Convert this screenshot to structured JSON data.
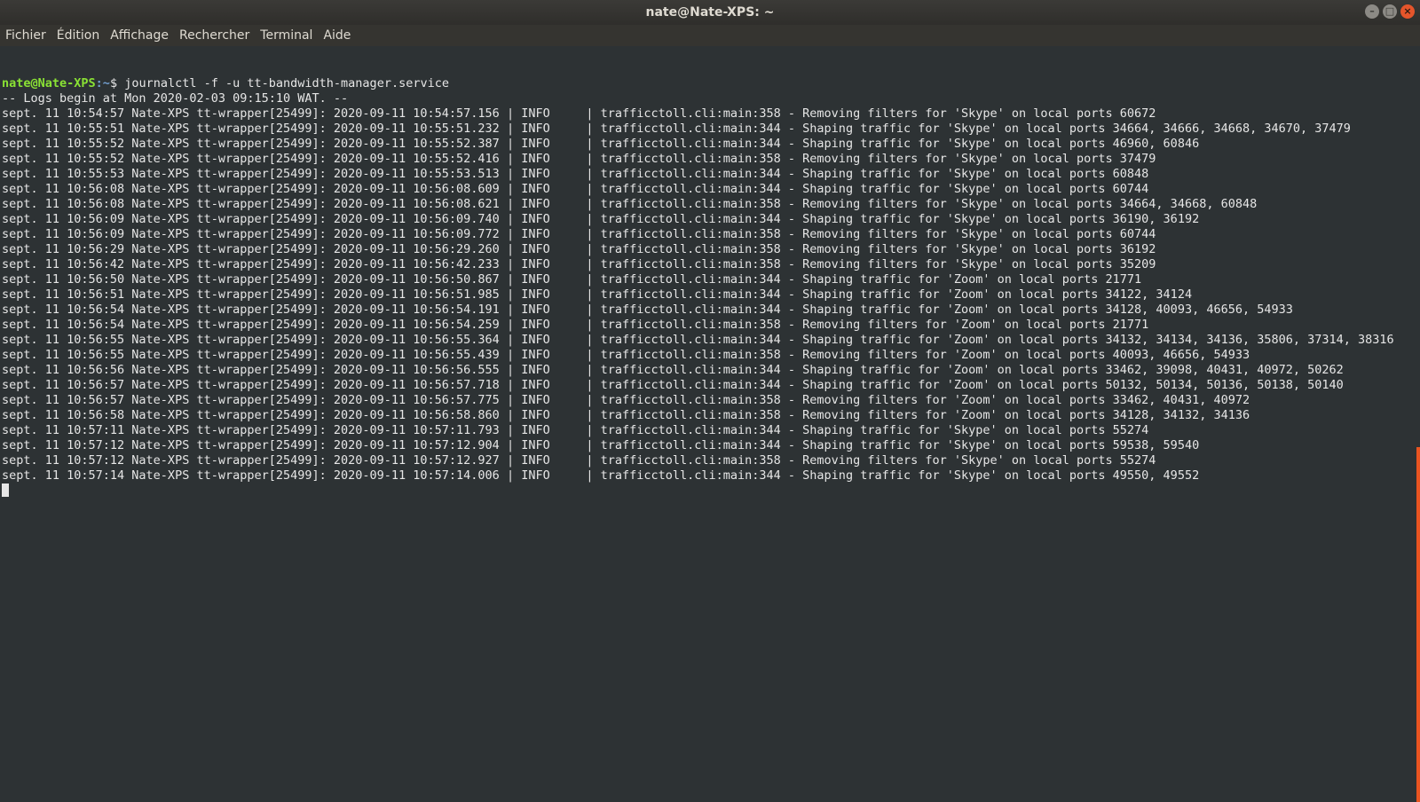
{
  "window": {
    "title": "nate@Nate-XPS: ~",
    "buttons": {
      "minimize": "–",
      "maximize": "□",
      "close": "×"
    }
  },
  "menu": [
    "Fichier",
    "Édition",
    "Affichage",
    "Rechercher",
    "Terminal",
    "Aide"
  ],
  "prompt": {
    "user_host": "nate@Nate-XPS",
    "path": ":~",
    "symbol": "$",
    "command": "journalctl -f -u tt-bandwidth-manager.service"
  },
  "logs_begin": "-- Logs begin at Mon 2020-02-03 09:15:10 WAT. --",
  "log_lines": [
    "sept. 11 10:54:57 Nate-XPS tt-wrapper[25499]: 2020-09-11 10:54:57.156 | INFO     | trafficctoll.cli:main:358 - Removing filters for 'Skype' on local ports 60672",
    "sept. 11 10:55:51 Nate-XPS tt-wrapper[25499]: 2020-09-11 10:55:51.232 | INFO     | trafficctoll.cli:main:344 - Shaping traffic for 'Skype' on local ports 34664, 34666, 34668, 34670, 37479",
    "sept. 11 10:55:52 Nate-XPS tt-wrapper[25499]: 2020-09-11 10:55:52.387 | INFO     | trafficctoll.cli:main:344 - Shaping traffic for 'Skype' on local ports 46960, 60846",
    "sept. 11 10:55:52 Nate-XPS tt-wrapper[25499]: 2020-09-11 10:55:52.416 | INFO     | trafficctoll.cli:main:358 - Removing filters for 'Skype' on local ports 37479",
    "sept. 11 10:55:53 Nate-XPS tt-wrapper[25499]: 2020-09-11 10:55:53.513 | INFO     | trafficctoll.cli:main:344 - Shaping traffic for 'Skype' on local ports 60848",
    "sept. 11 10:56:08 Nate-XPS tt-wrapper[25499]: 2020-09-11 10:56:08.609 | INFO     | trafficctoll.cli:main:344 - Shaping traffic for 'Skype' on local ports 60744",
    "sept. 11 10:56:08 Nate-XPS tt-wrapper[25499]: 2020-09-11 10:56:08.621 | INFO     | trafficctoll.cli:main:358 - Removing filters for 'Skype' on local ports 34664, 34668, 60848",
    "sept. 11 10:56:09 Nate-XPS tt-wrapper[25499]: 2020-09-11 10:56:09.740 | INFO     | trafficctoll.cli:main:344 - Shaping traffic for 'Skype' on local ports 36190, 36192",
    "sept. 11 10:56:09 Nate-XPS tt-wrapper[25499]: 2020-09-11 10:56:09.772 | INFO     | trafficctoll.cli:main:358 - Removing filters for 'Skype' on local ports 60744",
    "sept. 11 10:56:29 Nate-XPS tt-wrapper[25499]: 2020-09-11 10:56:29.260 | INFO     | trafficctoll.cli:main:358 - Removing filters for 'Skype' on local ports 36192",
    "sept. 11 10:56:42 Nate-XPS tt-wrapper[25499]: 2020-09-11 10:56:42.233 | INFO     | trafficctoll.cli:main:358 - Removing filters for 'Skype' on local ports 35209",
    "sept. 11 10:56:50 Nate-XPS tt-wrapper[25499]: 2020-09-11 10:56:50.867 | INFO     | trafficctoll.cli:main:344 - Shaping traffic for 'Zoom' on local ports 21771",
    "sept. 11 10:56:51 Nate-XPS tt-wrapper[25499]: 2020-09-11 10:56:51.985 | INFO     | trafficctoll.cli:main:344 - Shaping traffic for 'Zoom' on local ports 34122, 34124",
    "sept. 11 10:56:54 Nate-XPS tt-wrapper[25499]: 2020-09-11 10:56:54.191 | INFO     | trafficctoll.cli:main:344 - Shaping traffic for 'Zoom' on local ports 34128, 40093, 46656, 54933",
    "sept. 11 10:56:54 Nate-XPS tt-wrapper[25499]: 2020-09-11 10:56:54.259 | INFO     | trafficctoll.cli:main:358 - Removing filters for 'Zoom' on local ports 21771",
    "sept. 11 10:56:55 Nate-XPS tt-wrapper[25499]: 2020-09-11 10:56:55.364 | INFO     | trafficctoll.cli:main:344 - Shaping traffic for 'Zoom' on local ports 34132, 34134, 34136, 35806, 37314, 38316",
    "sept. 11 10:56:55 Nate-XPS tt-wrapper[25499]: 2020-09-11 10:56:55.439 | INFO     | trafficctoll.cli:main:358 - Removing filters for 'Zoom' on local ports 40093, 46656, 54933",
    "sept. 11 10:56:56 Nate-XPS tt-wrapper[25499]: 2020-09-11 10:56:56.555 | INFO     | trafficctoll.cli:main:344 - Shaping traffic for 'Zoom' on local ports 33462, 39098, 40431, 40972, 50262",
    "sept. 11 10:56:57 Nate-XPS tt-wrapper[25499]: 2020-09-11 10:56:57.718 | INFO     | trafficctoll.cli:main:344 - Shaping traffic for 'Zoom' on local ports 50132, 50134, 50136, 50138, 50140",
    "sept. 11 10:56:57 Nate-XPS tt-wrapper[25499]: 2020-09-11 10:56:57.775 | INFO     | trafficctoll.cli:main:358 - Removing filters for 'Zoom' on local ports 33462, 40431, 40972",
    "sept. 11 10:56:58 Nate-XPS tt-wrapper[25499]: 2020-09-11 10:56:58.860 | INFO     | trafficctoll.cli:main:358 - Removing filters for 'Zoom' on local ports 34128, 34132, 34136",
    "sept. 11 10:57:11 Nate-XPS tt-wrapper[25499]: 2020-09-11 10:57:11.793 | INFO     | trafficctoll.cli:main:344 - Shaping traffic for 'Skype' on local ports 55274",
    "sept. 11 10:57:12 Nate-XPS tt-wrapper[25499]: 2020-09-11 10:57:12.904 | INFO     | trafficctoll.cli:main:344 - Shaping traffic for 'Skype' on local ports 59538, 59540",
    "sept. 11 10:57:12 Nate-XPS tt-wrapper[25499]: 2020-09-11 10:57:12.927 | INFO     | trafficctoll.cli:main:358 - Removing filters for 'Skype' on local ports 55274",
    "sept. 11 10:57:14 Nate-XPS tt-wrapper[25499]: 2020-09-11 10:57:14.006 | INFO     | trafficctoll.cli:main:344 - Shaping traffic for 'Skype' on local ports 49550, 49552"
  ],
  "colors": {
    "background": "#2d3234",
    "text": "#e6e6e6",
    "prompt_user": "#8ae234",
    "prompt_path": "#729fcf",
    "scrollbar": "#e95420"
  }
}
